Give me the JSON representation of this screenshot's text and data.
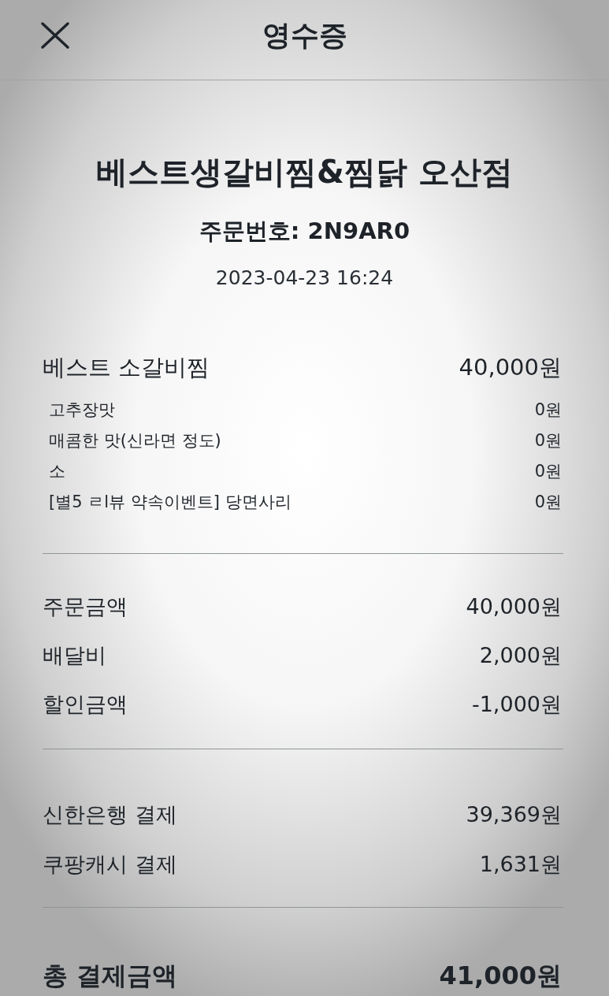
{
  "header": {
    "title": "영수증"
  },
  "store": {
    "name": "베스트생갈비찜&찜닭 오산점",
    "order_number": "주문번호: 2N9AR0",
    "date": "2023-04-23 16:24"
  },
  "items": [
    {
      "name": "베스트 소갈비찜",
      "price": "40,000원",
      "options": [
        {
          "name": "고추장맛",
          "price": "0원"
        },
        {
          "name": "매콤한 맛(신라면 정도)",
          "price": "0원"
        },
        {
          "name": "소",
          "price": "0원"
        },
        {
          "name": "[별5 ㄹl뷰 약속이벤트] 당면사리",
          "price": "0원"
        }
      ]
    }
  ],
  "summary": [
    {
      "label": "주문금액",
      "amount": "40,000원"
    },
    {
      "label": "배달비",
      "amount": "2,000원"
    },
    {
      "label": "할인금액",
      "amount": "-1,000원"
    }
  ],
  "payments": [
    {
      "label": "신한은행 결제",
      "amount": "39,369원"
    },
    {
      "label": "쿠팡캐시 결제",
      "amount": "1,631원"
    }
  ],
  "total": {
    "label": "총 결제금액",
    "amount": "41,000원"
  }
}
